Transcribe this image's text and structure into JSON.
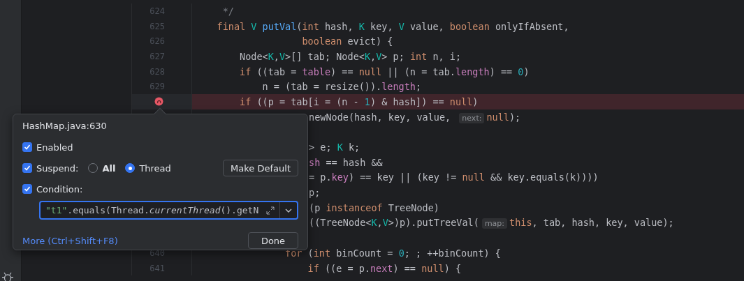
{
  "editor": {
    "lines": [
      {
        "number": "624",
        "breakpoint": false,
        "tokens": [
          {
            "text": "     */",
            "kind": "comment"
          }
        ]
      },
      {
        "number": "625",
        "breakpoint": false,
        "tokens": [
          {
            "text": "    final",
            "kind": "keyword"
          },
          {
            "text": " V",
            "kind": "type"
          },
          {
            "text": " putVal",
            "kind": "function"
          },
          {
            "text": "(",
            "kind": "plain"
          },
          {
            "text": "int",
            "kind": "keyword"
          },
          {
            "text": " hash, ",
            "kind": "plain"
          },
          {
            "text": "K",
            "kind": "type"
          },
          {
            "text": " key, ",
            "kind": "plain"
          },
          {
            "text": "V",
            "kind": "type"
          },
          {
            "text": " value, ",
            "kind": "plain"
          },
          {
            "text": "boolean",
            "kind": "keyword"
          },
          {
            "text": " onlyIfAbsent,",
            "kind": "plain"
          }
        ]
      },
      {
        "number": "626",
        "breakpoint": false,
        "tokens": [
          {
            "text": "                   boolean",
            "kind": "keyword"
          },
          {
            "text": " evict) {",
            "kind": "plain"
          }
        ]
      },
      {
        "number": "627",
        "breakpoint": false,
        "tokens": [
          {
            "text": "        Node<",
            "kind": "plain"
          },
          {
            "text": "K",
            "kind": "type"
          },
          {
            "text": ",",
            "kind": "plain"
          },
          {
            "text": "V",
            "kind": "type"
          },
          {
            "text": ">[] tab; Node<",
            "kind": "plain"
          },
          {
            "text": "K",
            "kind": "type"
          },
          {
            "text": ",",
            "kind": "plain"
          },
          {
            "text": "V",
            "kind": "type"
          },
          {
            "text": "> p; ",
            "kind": "plain"
          },
          {
            "text": "int",
            "kind": "keyword"
          },
          {
            "text": " n, i;",
            "kind": "plain"
          }
        ]
      },
      {
        "number": "628",
        "breakpoint": false,
        "tokens": [
          {
            "text": "        if",
            "kind": "keyword"
          },
          {
            "text": " ((tab = ",
            "kind": "plain"
          },
          {
            "text": "table",
            "kind": "field"
          },
          {
            "text": ") == ",
            "kind": "plain"
          },
          {
            "text": "null",
            "kind": "keyword"
          },
          {
            "text": " || (n = tab.",
            "kind": "plain"
          },
          {
            "text": "length",
            "kind": "field"
          },
          {
            "text": ") == ",
            "kind": "plain"
          },
          {
            "text": "0",
            "kind": "number"
          },
          {
            "text": ")",
            "kind": "plain"
          }
        ]
      },
      {
        "number": "629",
        "breakpoint": false,
        "tokens": [
          {
            "text": "            n = (tab = resize()).",
            "kind": "plain"
          },
          {
            "text": "length",
            "kind": "field"
          },
          {
            "text": ";",
            "kind": "plain"
          }
        ]
      },
      {
        "breakpoint": true,
        "tokens": [
          {
            "text": "        if",
            "kind": "keyword"
          },
          {
            "text": " ((p = tab[i = (n - ",
            "kind": "plain"
          },
          {
            "text": "1",
            "kind": "number"
          },
          {
            "text": ") & hash]) == ",
            "kind": "plain"
          },
          {
            "text": "null",
            "kind": "keyword"
          },
          {
            "text": ")",
            "kind": "plain"
          }
        ]
      },
      {
        "clipped": true,
        "breakpoint": false,
        "tokens": [
          {
            "text": "newNode(hash, key, value, ",
            "kind": "plain"
          },
          {
            "text": "next:",
            "kind": "hint"
          },
          {
            "text": "null",
            "kind": "keyword"
          },
          {
            "text": ");",
            "kind": "plain"
          }
        ]
      },
      {
        "breakpoint": false
      },
      {
        "clipped": true,
        "breakpoint": false,
        "tokens": [
          {
            "text": "> e; ",
            "kind": "plain"
          },
          {
            "text": "K",
            "kind": "type"
          },
          {
            "text": " k;",
            "kind": "plain"
          }
        ]
      },
      {
        "clipped": true,
        "breakpoint": false,
        "tokens": [
          {
            "text": "sh",
            "kind": "field"
          },
          {
            "text": " == hash &&",
            "kind": "plain"
          }
        ]
      },
      {
        "clipped": true,
        "breakpoint": false,
        "tokens": [
          {
            "text": "= p.",
            "kind": "plain"
          },
          {
            "text": "key",
            "kind": "field"
          },
          {
            "text": ") == key || (key != ",
            "kind": "plain"
          },
          {
            "text": "null",
            "kind": "keyword"
          },
          {
            "text": " && key.equals(k))))",
            "kind": "plain"
          }
        ]
      },
      {
        "clipped": true,
        "breakpoint": false,
        "tokens": [
          {
            "text": "p;",
            "kind": "plain"
          }
        ]
      },
      {
        "clipped": true,
        "breakpoint": false,
        "tokens": [
          {
            "text": "(p ",
            "kind": "plain"
          },
          {
            "text": "instanceof",
            "kind": "keyword"
          },
          {
            "text": " TreeNode)",
            "kind": "plain"
          }
        ]
      },
      {
        "clipped": true,
        "breakpoint": false,
        "tokens": [
          {
            "text": "((TreeNode<",
            "kind": "plain"
          },
          {
            "text": "K",
            "kind": "type"
          },
          {
            "text": ",",
            "kind": "plain"
          },
          {
            "text": "V",
            "kind": "type"
          },
          {
            "text": ">)p).putTreeVal(",
            "kind": "plain"
          },
          {
            "text": "map:",
            "kind": "hint"
          },
          {
            "text": "this",
            "kind": "keyword"
          },
          {
            "text": ", tab, hash, key, value);",
            "kind": "plain"
          }
        ]
      },
      {
        "breakpoint": false
      },
      {
        "number": "640",
        "breakpoint": false,
        "tokens": [
          {
            "text": "                for",
            "kind": "keyword"
          },
          {
            "text": " (",
            "kind": "plain"
          },
          {
            "text": "int",
            "kind": "keyword"
          },
          {
            "text": " binCount = ",
            "kind": "plain"
          },
          {
            "text": "0",
            "kind": "number"
          },
          {
            "text": "; ; ++binCount) {",
            "kind": "plain"
          }
        ]
      },
      {
        "number": "641",
        "breakpoint": false,
        "tokens": [
          {
            "text": "                    if",
            "kind": "keyword"
          },
          {
            "text": " ((e = p.",
            "kind": "plain"
          },
          {
            "text": "next",
            "kind": "field"
          },
          {
            "text": ") == ",
            "kind": "plain"
          },
          {
            "text": "null",
            "kind": "keyword"
          },
          {
            "text": ") {",
            "kind": "plain"
          }
        ]
      }
    ]
  },
  "breakpoint_popup": {
    "title": "HashMap.java:630",
    "enabled": {
      "label": "Enabled",
      "checked": true
    },
    "suspend": {
      "label": "Suspend:",
      "checked": true,
      "options": [
        {
          "label": "All",
          "selected": false
        },
        {
          "label": "Thread",
          "selected": true
        }
      ]
    },
    "make_default_button": "Make Default",
    "condition": {
      "label": "Condition:",
      "checked": true,
      "value": [
        {
          "text": "\"t1\"",
          "kind": "string"
        },
        {
          "text": ".equals(Thread.",
          "kind": "plain"
        },
        {
          "text": "currentThread",
          "kind": "italic"
        },
        {
          "text": "().getN",
          "kind": "plain"
        }
      ]
    },
    "more_link": "More (Ctrl+Shift+F8)",
    "done_button": "Done"
  }
}
